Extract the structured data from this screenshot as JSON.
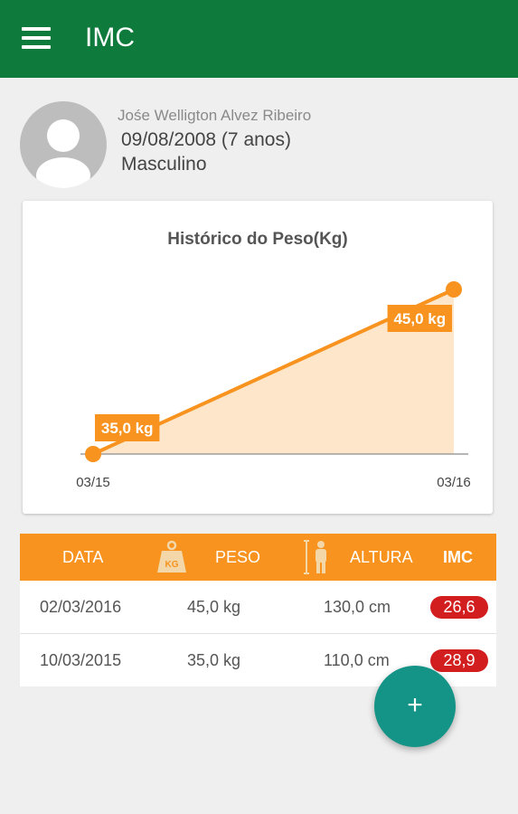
{
  "appbar": {
    "title": "IMC",
    "menu_icon": "hamburger-menu-icon"
  },
  "profile": {
    "avatar_icon": "person-placeholder-icon",
    "name": "Jośe Welligton Alvez Ribeiro",
    "birth": "09/08/2008 (7 anos)",
    "gender": "Masculino"
  },
  "colors": {
    "appbar": "#0e7a3c",
    "accent": "#f7931e",
    "badge": "#d21e1e",
    "fab": "#149487"
  },
  "chart_data": {
    "type": "area",
    "title": "Histórico do Peso(Kg)",
    "categories": [
      "03/15",
      "03/16"
    ],
    "values": [
      35.0,
      45.0
    ],
    "labels": [
      "35,0 kg",
      "45,0 kg"
    ],
    "ylim": [
      35,
      45
    ],
    "grid": false,
    "legend": "none"
  },
  "table": {
    "headers": {
      "date": "DATA",
      "weight": "PESO",
      "height": "ALTURA",
      "imc": "IMC"
    },
    "weight_icon": "weight-kg-icon",
    "weight_icon_text": "KG",
    "height_icon": "height-person-icon",
    "rows": [
      {
        "date": "02/03/2016",
        "weight": "45,0 kg",
        "height": "130,0 cm",
        "imc": "26,6"
      },
      {
        "date": "10/03/2015",
        "weight": "35,0 kg",
        "height": "110,0 cm",
        "imc": "28,9"
      }
    ]
  },
  "fab": {
    "label": "+",
    "icon": "add-icon"
  }
}
